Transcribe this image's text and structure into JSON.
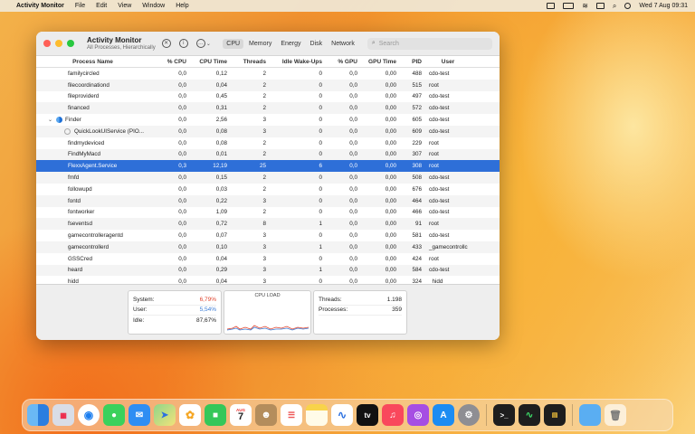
{
  "menubar": {
    "app_name": "Activity Monitor",
    "menus": [
      "File",
      "Edit",
      "View",
      "Window",
      "Help"
    ],
    "datetime": "Wed 7 Aug  09:31"
  },
  "window": {
    "title": "Activity Monitor",
    "subtitle": "All Processes, Hierarchically",
    "tabs": [
      "CPU",
      "Memory",
      "Energy",
      "Disk",
      "Network"
    ],
    "active_tab": "CPU",
    "search_placeholder": "Search"
  },
  "table": {
    "headers": [
      "Process Name",
      "% CPU",
      "CPU Time",
      "Threads",
      "Idle Wake-Ups",
      "% GPU",
      "GPU Time",
      "PID",
      "User"
    ],
    "rows": [
      {
        "name": "familycircled",
        "cpu": "0,0",
        "cput": "0,12",
        "thr": "2",
        "idle": "0",
        "gpu": "0,0",
        "gput": "0,00",
        "pid": "488",
        "user": "cdo-test"
      },
      {
        "name": "filecoordinationd",
        "cpu": "0,0",
        "cput": "0,04",
        "thr": "2",
        "idle": "0",
        "gpu": "0,0",
        "gput": "0,00",
        "pid": "515",
        "user": "root"
      },
      {
        "name": "fileproviderd",
        "cpu": "0,0",
        "cput": "0,45",
        "thr": "2",
        "idle": "0",
        "gpu": "0,0",
        "gput": "0,00",
        "pid": "497",
        "user": "cdo-test"
      },
      {
        "name": "financed",
        "cpu": "0,0",
        "cput": "0,31",
        "thr": "2",
        "idle": "0",
        "gpu": "0,0",
        "gput": "0,00",
        "pid": "572",
        "user": "cdo-test"
      },
      {
        "name": "Finder",
        "cpu": "0,0",
        "cput": "2,56",
        "thr": "3",
        "idle": "0",
        "gpu": "0,0",
        "gput": "0,00",
        "pid": "605",
        "user": "cdo-test"
      },
      {
        "name": "QuickLookUIService (PIO...",
        "cpu": "0,0",
        "cput": "0,08",
        "thr": "3",
        "idle": "0",
        "gpu": "0,0",
        "gput": "0,00",
        "pid": "609",
        "user": "cdo-test"
      },
      {
        "name": "findmydeviced",
        "cpu": "0,0",
        "cput": "0,08",
        "thr": "2",
        "idle": "0",
        "gpu": "0,0",
        "gput": "0,00",
        "pid": "229",
        "user": "root"
      },
      {
        "name": "FindMyMacd",
        "cpu": "0,0",
        "cput": "0,01",
        "thr": "2",
        "idle": "0",
        "gpu": "0,0",
        "gput": "0,00",
        "pid": "307",
        "user": "root"
      },
      {
        "name": "FlexxAgent.Service",
        "cpu": "0,3",
        "cput": "12,19",
        "thr": "25",
        "idle": "6",
        "gpu": "0,0",
        "gput": "0,00",
        "pid": "308",
        "user": "root"
      },
      {
        "name": "fmfd",
        "cpu": "0,0",
        "cput": "0,15",
        "thr": "2",
        "idle": "0",
        "gpu": "0,0",
        "gput": "0,00",
        "pid": "508",
        "user": "cdo-test"
      },
      {
        "name": "followupd",
        "cpu": "0,0",
        "cput": "0,03",
        "thr": "2",
        "idle": "0",
        "gpu": "0,0",
        "gput": "0,00",
        "pid": "676",
        "user": "cdo-test"
      },
      {
        "name": "fontd",
        "cpu": "0,0",
        "cput": "0,22",
        "thr": "3",
        "idle": "0",
        "gpu": "0,0",
        "gput": "0,00",
        "pid": "464",
        "user": "cdo-test"
      },
      {
        "name": "fontworker",
        "cpu": "0,0",
        "cput": "1,09",
        "thr": "2",
        "idle": "0",
        "gpu": "0,0",
        "gput": "0,00",
        "pid": "466",
        "user": "cdo-test"
      },
      {
        "name": "fseventsd",
        "cpu": "0,0",
        "cput": "0,72",
        "thr": "8",
        "idle": "1",
        "gpu": "0,0",
        "gput": "0,00",
        "pid": "91",
        "user": "root"
      },
      {
        "name": "gamecontrolleragentd",
        "cpu": "0,0",
        "cput": "0,07",
        "thr": "3",
        "idle": "0",
        "gpu": "0,0",
        "gput": "0,00",
        "pid": "581",
        "user": "cdo-test"
      },
      {
        "name": "gamecontrollerd",
        "cpu": "0,0",
        "cput": "0,10",
        "thr": "3",
        "idle": "1",
        "gpu": "0,0",
        "gput": "0,00",
        "pid": "433",
        "user": "_gamecontrollc"
      },
      {
        "name": "GSSCred",
        "cpu": "0,0",
        "cput": "0,04",
        "thr": "3",
        "idle": "0",
        "gpu": "0,0",
        "gput": "0,00",
        "pid": "424",
        "user": "root"
      },
      {
        "name": "heard",
        "cpu": "0,0",
        "cput": "0,29",
        "thr": "3",
        "idle": "1",
        "gpu": "0,0",
        "gput": "0,00",
        "pid": "584",
        "user": "cdo-test"
      },
      {
        "name": "hidd",
        "cpu": "0,0",
        "cput": "0,04",
        "thr": "3",
        "idle": "0",
        "gpu": "0,0",
        "gput": "0,00",
        "pid": "324",
        "user": "_hidd"
      }
    ]
  },
  "stats": {
    "system_label": "System:",
    "system_value": "6,79%",
    "user_label": "User:",
    "user_value": "5,54%",
    "idle_label": "Idle:",
    "idle_value": "87,67%",
    "cpu_load_title": "CPU LOAD",
    "threads_label": "Threads:",
    "threads_value": "1.198",
    "processes_label": "Processes:",
    "processes_value": "359"
  },
  "dock": {
    "calendar_month": "AUG",
    "calendar_day": "7",
    "tv_label": "tv"
  },
  "colors": {
    "selection": "#2e6fd8",
    "system_red": "#e0442e",
    "user_blue": "#3a7bd5"
  }
}
